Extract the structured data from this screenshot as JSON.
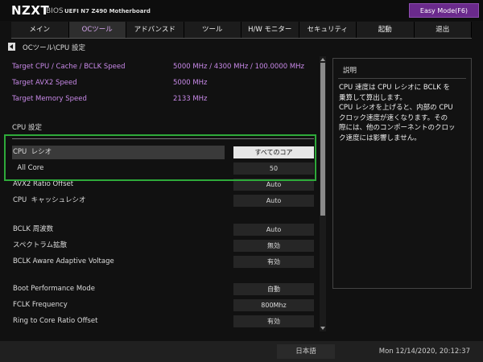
{
  "header": {
    "brand": "NZXT",
    "bios": "BIOS",
    "model": "UEFI  N7 Z490 Motherboard",
    "easy_mode": "Easy Mode(F6)"
  },
  "tabs": [
    {
      "label": "メイン",
      "active": false
    },
    {
      "label": "OCツール",
      "active": true
    },
    {
      "label": "アドバンスド",
      "active": false
    },
    {
      "label": "ツール",
      "active": false
    },
    {
      "label": "H/W モニター",
      "active": false
    },
    {
      "label": "セキュリティ",
      "active": false
    },
    {
      "label": "起動",
      "active": false
    },
    {
      "label": "退出",
      "active": false
    }
  ],
  "breadcrumb": "OCツール\\CPU 設定",
  "info": [
    {
      "label": "Target CPU / Cache / BCLK Speed",
      "value": "5000 MHz / 4300 MHz / 100.0000 MHz"
    },
    {
      "label": "Target AVX2 Speed",
      "value": "5000 MHz"
    },
    {
      "label": "Target Memory Speed",
      "value": "2133 MHz"
    }
  ],
  "section_title": "CPU 設定",
  "settings": [
    {
      "label": "CPU  レシオ",
      "value": "すべてのコア",
      "selected": true
    },
    {
      "label": "  All Core",
      "value": "50",
      "selected": false
    },
    {
      "label": "AVX2 Ratio Offset",
      "value": "Auto",
      "selected": false
    },
    {
      "label": "CPU  キャッシュレシオ",
      "value": "Auto",
      "selected": false
    },
    {
      "label": "BCLK 周波数",
      "value": "Auto",
      "selected": false
    },
    {
      "label": "スペクトラム拡散",
      "value": "無効",
      "selected": false
    },
    {
      "label": "BCLK Aware Adaptive Voltage",
      "value": "有効",
      "selected": false
    },
    {
      "label": "Boot Performance Mode",
      "value": "自動",
      "selected": false
    },
    {
      "label": "FCLK Frequency",
      "value": "800Mhz",
      "selected": false
    },
    {
      "label": "Ring to Core Ratio Offset",
      "value": "有効",
      "selected": false
    }
  ],
  "help": {
    "title": "説明",
    "text": "CPU 速度は CPU レシオに BCLK を\n乗算して算出します。\nCPU レシオを上げると、内部の CPU\nクロック速度が速くなります。その\n際には、他のコンポーネントのクロッ\nク速度には影響しません。"
  },
  "footer": {
    "language": "日本語",
    "datetime": "Mon 12/14/2020, 20:12:37"
  },
  "colors": {
    "accent_purple": "#6a2a8c",
    "info_text": "#c889e8",
    "highlight_green": "#2eaa3a"
  }
}
